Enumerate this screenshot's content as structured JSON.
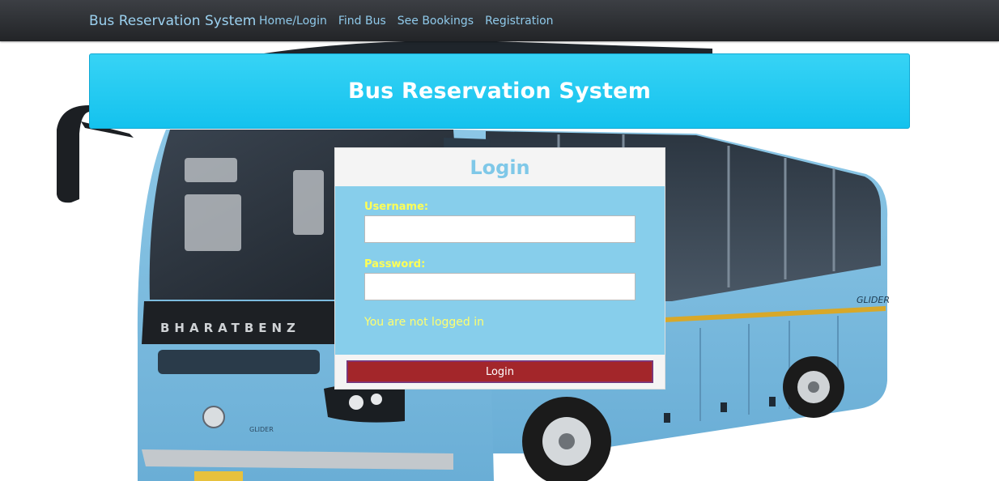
{
  "navbar": {
    "brand": "Bus Reservation System",
    "links": [
      "Home/Login",
      "Find Bus",
      "See Bookings",
      "Registration"
    ]
  },
  "jumbotron": {
    "title": "Bus Reservation System"
  },
  "bus_image": {
    "front_lettering": "BHARATBENZ",
    "side_badge": "GLIDER",
    "grille_badge": "GLIDER"
  },
  "login": {
    "title": "Login",
    "username_label": "Username:",
    "username_value": "",
    "password_label": "Password:",
    "password_value": "",
    "status": "You are not logged in",
    "button_label": "Login"
  },
  "colors": {
    "navbar": "#2d3034",
    "brand_text": "#9bd1f0",
    "jumbotron": "#1ec8f2",
    "login_panel": "#87ceeb",
    "label_yellow": "#ffff55",
    "login_button": "#a3262a",
    "bus_body": "#7ebde0"
  },
  "icons": [
    "bus-image"
  ]
}
